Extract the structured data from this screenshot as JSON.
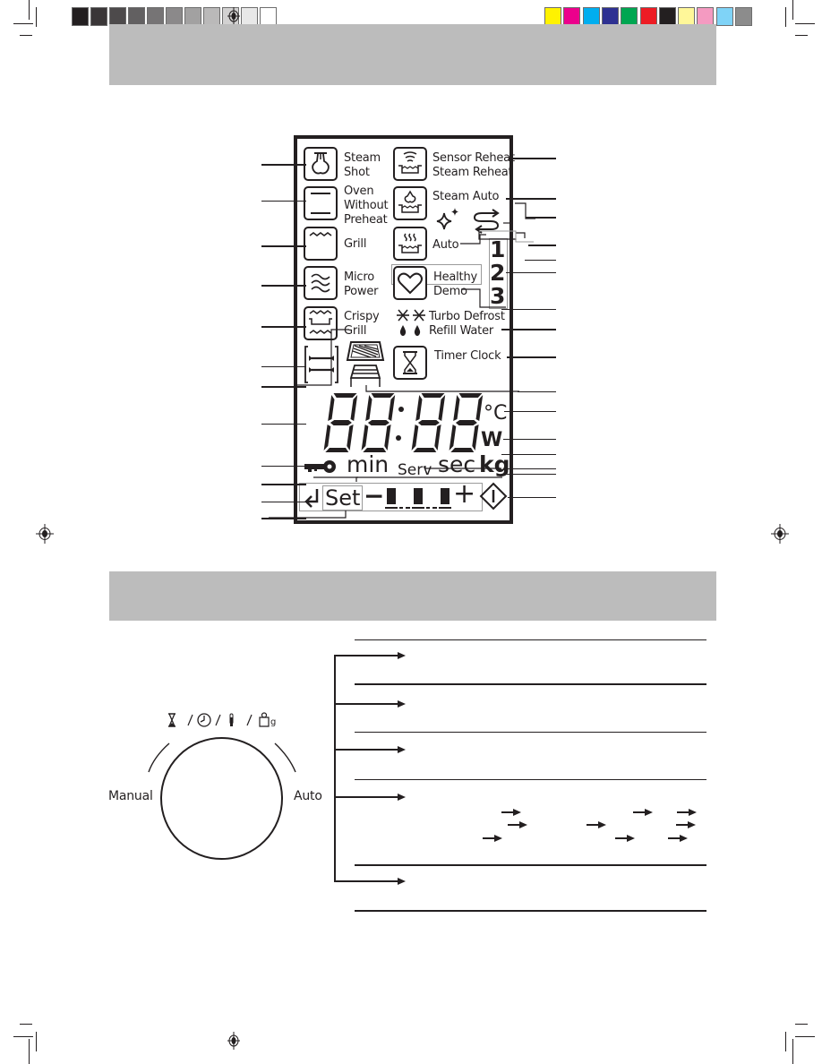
{
  "print_marks": {
    "grayscale_swatches": [
      "#231f20",
      "#3a3637",
      "#4d4a4b",
      "#626061",
      "#767475",
      "#8b898a",
      "#a2a1a1",
      "#bab9b9",
      "#d2d1d1",
      "#e8e8e8",
      "#ffffff"
    ],
    "color_swatches": [
      "#fff200",
      "#ec008c",
      "#00aeef",
      "#2e3192",
      "#00a651",
      "#ed1c24",
      "#231f20",
      "#fff799",
      "#f49ac1",
      "#7fd3f7",
      "#8c8c8c"
    ],
    "band_color": "#bcbcbc"
  },
  "display_panel": {
    "left_icons": [
      {
        "icon": "steam-shot-icon",
        "label_lines": [
          "Steam",
          "Shot"
        ]
      },
      {
        "icon": "oven-without-preheat-icon",
        "label_lines": [
          "Oven",
          "Without",
          "Preheat"
        ]
      },
      {
        "icon": "grill-icon",
        "label_lines": [
          "Grill"
        ]
      },
      {
        "icon": "micro-power-icon",
        "label_lines": [
          "Micro",
          "Power"
        ]
      },
      {
        "icon": "crispy-grill-icon",
        "label_lines": [
          "Crispy",
          "Grill"
        ]
      },
      {
        "icon": "rack-level-icon",
        "label_lines": []
      }
    ],
    "right_icons": [
      {
        "icon": "sensor-reheat-icon",
        "label_lines": [
          "Sensor Reheat",
          "Steam Reheat"
        ]
      },
      {
        "icon": "steam-auto-icon",
        "label_lines": [
          "Steam Auto"
        ]
      },
      {
        "icon": "auto-icon",
        "label_lines": [
          "Auto"
        ]
      },
      {
        "icon": "healthy-heart-icon",
        "label_lines": [
          "Healthy",
          "Demo"
        ]
      },
      {
        "icon": "timer-clock-icon",
        "label_lines": [
          "Timer Clock"
        ]
      }
    ],
    "step_numbers": [
      "1",
      "2",
      "3"
    ],
    "turbo_defrost": "Turbo Defrost",
    "refill_water": "Refill Water",
    "time_digits": "88:88",
    "unit_celsius": "°C",
    "unit_watt": "W",
    "unit_min": "min",
    "unit_serv": "Serv",
    "unit_sec": "sec",
    "unit_kg": "kg",
    "set_label": "Set",
    "minus": "−",
    "plus": "+",
    "level_segments": 3
  },
  "dial_section": {
    "dial_modes": [
      "timer-icon",
      "clock-icon",
      "thermometer-icon",
      "weight-icon"
    ],
    "weight_suffix": "g",
    "separator": "/",
    "manual_label": "Manual",
    "auto_label": "Auto",
    "branch_rows": 5
  }
}
